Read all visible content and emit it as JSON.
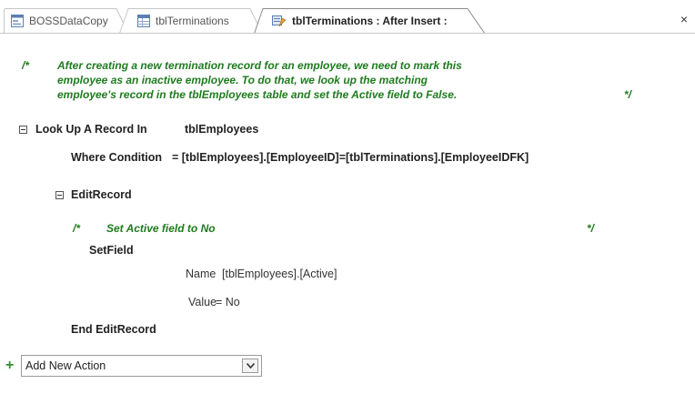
{
  "tabs": [
    {
      "label": "BOSSDataCopy",
      "icon": "form-icon"
    },
    {
      "label": "tblTerminations",
      "icon": "table-icon"
    },
    {
      "label": "tblTerminations : After Insert :",
      "icon": "macro-icon",
      "active": true
    }
  ],
  "close_label": "×",
  "comment_block": {
    "open": "/*",
    "lines": [
      "After creating a new termination record for an employee, we need to mark this",
      "employee as an inactive employee. To do that, we look up the matching",
      "employee's record in the tblEmployees table and set the Active field to False."
    ],
    "close": "*/"
  },
  "lookup": {
    "action": "Look Up A Record In",
    "table": "tblEmployees",
    "where_label": "Where Condition",
    "where_value": "= [tblEmployees].[EmployeeID]=[tblTerminations].[EmployeeIDFK]"
  },
  "edit_record": {
    "label": "EditRecord",
    "comment_open": "/*",
    "comment_text": "Set Active field to No",
    "comment_close": "*/",
    "setfield_label": "SetField",
    "name_label": "Name",
    "name_value": "[tblEmployees].[Active]",
    "value_label": "Value",
    "value_value": "= No",
    "end_label": "End EditRecord"
  },
  "add_action": {
    "placeholder": "Add New Action"
  },
  "colors": {
    "comment": "#1e7b1e",
    "add_icon": "#2f8f2f"
  }
}
